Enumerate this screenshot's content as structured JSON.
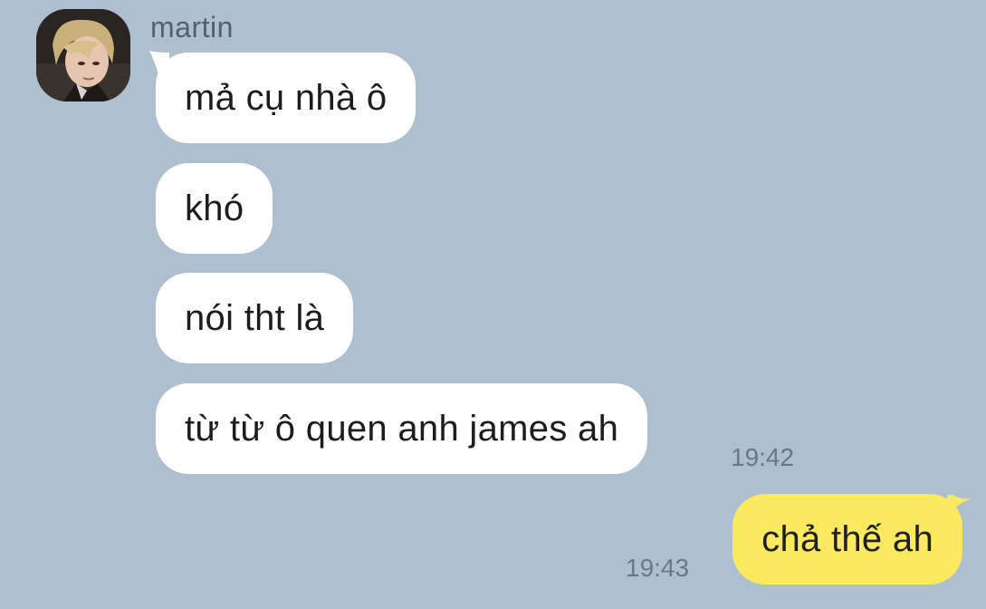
{
  "chat": {
    "incoming": {
      "sender_name": "martin",
      "messages": [
        "mả cụ nhà ô",
        "khó",
        "nói tht là",
        "từ từ ô quen anh james ah"
      ],
      "last_time": "19:42"
    },
    "outgoing": {
      "messages": [
        "chả thế ah"
      ],
      "time": "19:43"
    }
  },
  "colors": {
    "background": "#aebfd0",
    "incoming_bubble": "#ffffff",
    "outgoing_bubble": "#fbe960",
    "timestamp": "#6b7785",
    "sender_name": "#56606d"
  },
  "icons": {
    "avatar": "profile-photo"
  }
}
